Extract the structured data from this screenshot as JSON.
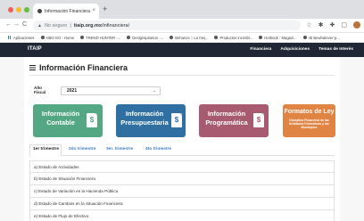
{
  "browser": {
    "tab_title": "Información Financiera",
    "tab_close": "×",
    "new_tab": "+",
    "url_prefix": "No seguro",
    "url_host": "itaip.org.mx",
    "url_path": "/infinanciera/",
    "bookmarks": [
      {
        "label": "Aplicaciones"
      },
      {
        "label": "HBO GO - Home"
      },
      {
        "label": "TREND HUNTER -..."
      },
      {
        "label": "Designspiration -..."
      },
      {
        "label": "Behance :: Lo mej..."
      },
      {
        "label": "Productos increibl..."
      },
      {
        "label": "Hotbook - Magazi..."
      },
      {
        "label": "45 Bewhatever-p..."
      }
    ]
  },
  "site": {
    "logo": "ITAIP",
    "menu": [
      "Financiera",
      "Adquisiciones",
      "Temas de Interés"
    ]
  },
  "page": {
    "title": "Información Financiera",
    "year_label": "Año Fiscal",
    "year_value": "2021",
    "tiles": {
      "contable": {
        "line1": "Información",
        "line2": "Contable",
        "color": "#53a783"
      },
      "presupuestaria": {
        "line1": "Información",
        "line2": "Presupuestaria",
        "color": "#2f6fa1"
      },
      "programatica": {
        "line1": "Información",
        "line2": "Programática",
        "color": "#a75a70"
      },
      "ley": {
        "title": "Formatos de Ley",
        "subtitle": "Disciplina Financiera de las Entidades Federativas y los Municipios",
        "color": "#e08444"
      }
    },
    "tabs": [
      "1er trimestre",
      "2do trimestre",
      "3er. trimestre",
      "4to trimestre"
    ],
    "rows": [
      "a) Estado de Actividades",
      "b) Estado de Situación Financiera",
      "c) Estado de Variación en la Hacienda Pública",
      "d) Estado de Cambios en la Situación Financiera",
      "e) Estado de Flujo de Efectivo"
    ]
  }
}
